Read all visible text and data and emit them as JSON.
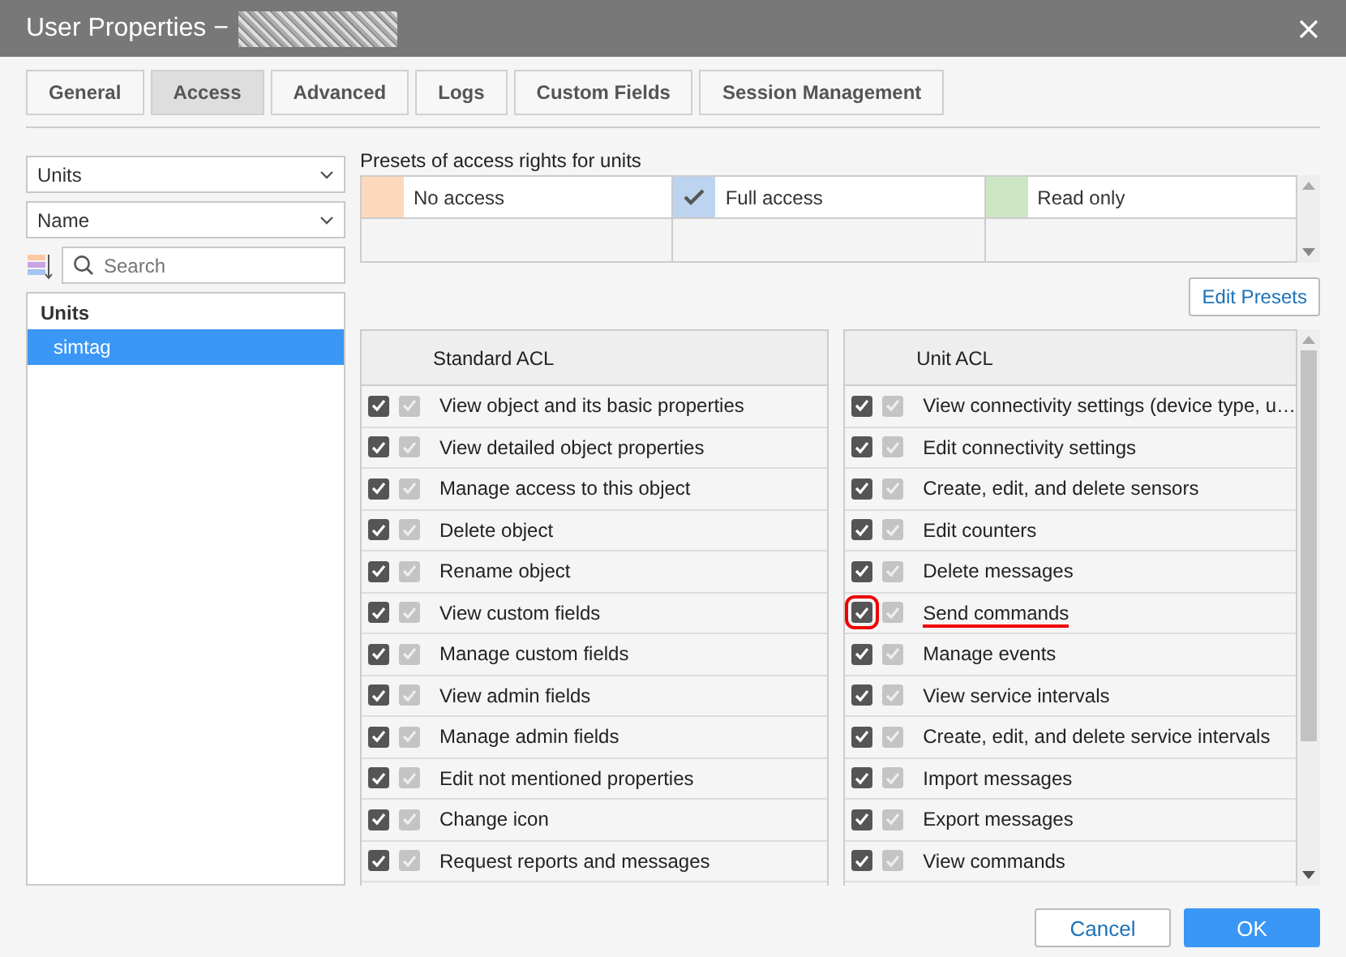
{
  "window": {
    "title": "User Properties −"
  },
  "tabs": [
    {
      "label": "General",
      "selected": false
    },
    {
      "label": "Access",
      "selected": true
    },
    {
      "label": "Advanced",
      "selected": false
    },
    {
      "label": "Logs",
      "selected": false
    },
    {
      "label": "Custom Fields",
      "selected": false
    },
    {
      "label": "Session Management",
      "selected": false
    }
  ],
  "filters": {
    "type": "Units",
    "sort": "Name",
    "search": {
      "placeholder": "Search"
    }
  },
  "object_list": {
    "header": "Units",
    "items": [
      {
        "label": "simtag",
        "selected": true
      }
    ]
  },
  "presets": {
    "title": "Presets of access rights for units",
    "items": [
      {
        "label": "No access",
        "color": "#fcd9bd",
        "checked": false
      },
      {
        "label": "Full access",
        "color": "#bdd4f0",
        "checked": true
      },
      {
        "label": "Read only",
        "color": "#cce6c4",
        "checked": false
      }
    ],
    "edit_button": "Edit Presets"
  },
  "standard_acl": {
    "title": "Standard ACL",
    "rows": [
      {
        "label": "View object and its basic properties",
        "checked": true,
        "inherited": true,
        "highlighted": false
      },
      {
        "label": "View detailed object properties",
        "checked": true,
        "inherited": true,
        "highlighted": false
      },
      {
        "label": "Manage access to this object",
        "checked": true,
        "inherited": true,
        "highlighted": false
      },
      {
        "label": "Delete object",
        "checked": true,
        "inherited": true,
        "highlighted": false
      },
      {
        "label": "Rename object",
        "checked": true,
        "inherited": true,
        "highlighted": false
      },
      {
        "label": "View custom fields",
        "checked": true,
        "inherited": true,
        "highlighted": false
      },
      {
        "label": "Manage custom fields",
        "checked": true,
        "inherited": true,
        "highlighted": false
      },
      {
        "label": "View admin fields",
        "checked": true,
        "inherited": true,
        "highlighted": false
      },
      {
        "label": "Manage admin fields",
        "checked": true,
        "inherited": true,
        "highlighted": false
      },
      {
        "label": "Edit not mentioned properties",
        "checked": true,
        "inherited": true,
        "highlighted": false
      },
      {
        "label": "Change icon",
        "checked": true,
        "inherited": true,
        "highlighted": false
      },
      {
        "label": "Request reports and messages",
        "checked": true,
        "inherited": true,
        "highlighted": false
      }
    ]
  },
  "unit_acl": {
    "title": "Unit ACL",
    "rows": [
      {
        "label": "View connectivity settings (device type, u…",
        "checked": true,
        "inherited": true,
        "highlighted": false
      },
      {
        "label": "Edit connectivity settings",
        "checked": true,
        "inherited": true,
        "highlighted": false
      },
      {
        "label": "Create, edit, and delete sensors",
        "checked": true,
        "inherited": true,
        "highlighted": false
      },
      {
        "label": "Edit counters",
        "checked": true,
        "inherited": true,
        "highlighted": false
      },
      {
        "label": "Delete messages",
        "checked": true,
        "inherited": true,
        "highlighted": false
      },
      {
        "label": "Send commands",
        "checked": true,
        "inherited": true,
        "highlighted": true
      },
      {
        "label": "Manage events",
        "checked": true,
        "inherited": true,
        "highlighted": false
      },
      {
        "label": "View service intervals",
        "checked": true,
        "inherited": true,
        "highlighted": false
      },
      {
        "label": "Create, edit, and delete service intervals",
        "checked": true,
        "inherited": true,
        "highlighted": false
      },
      {
        "label": "Import messages",
        "checked": true,
        "inherited": true,
        "highlighted": false
      },
      {
        "label": "Export messages",
        "checked": true,
        "inherited": true,
        "highlighted": false
      },
      {
        "label": "View commands",
        "checked": true,
        "inherited": true,
        "highlighted": false
      }
    ]
  },
  "buttons": {
    "cancel": "Cancel",
    "ok": "OK"
  }
}
